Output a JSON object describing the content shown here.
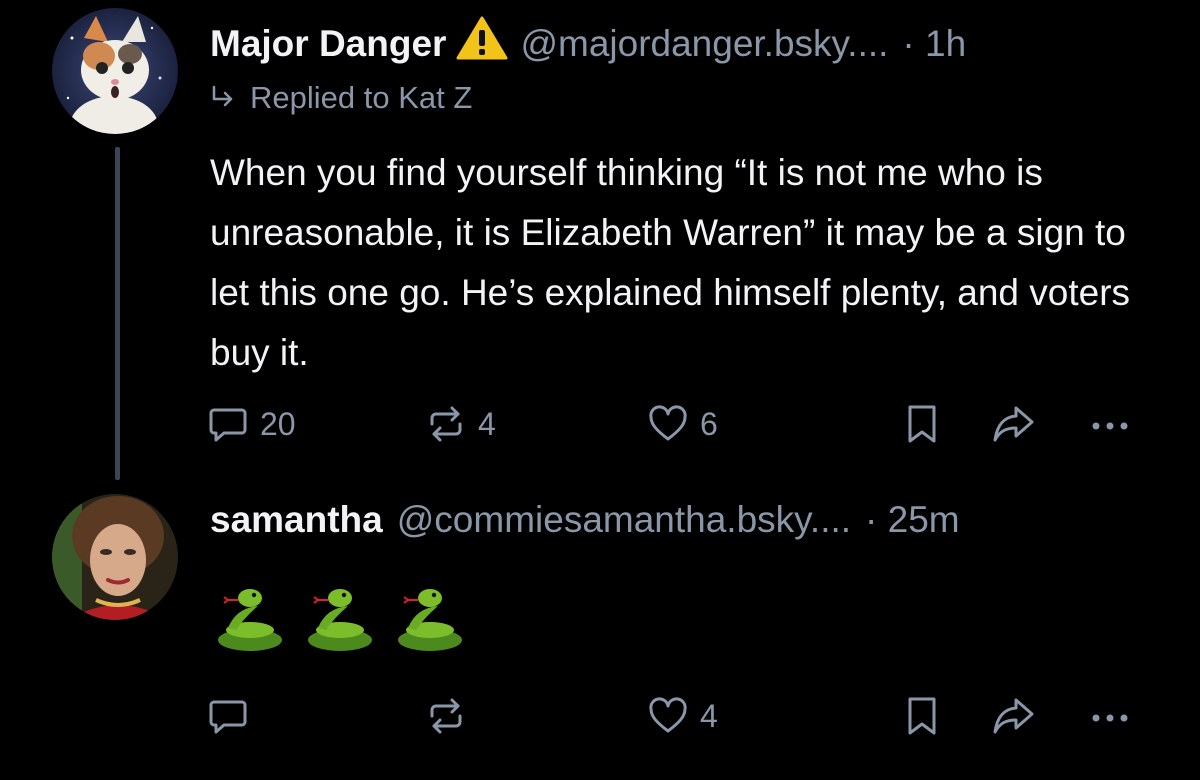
{
  "post1": {
    "author_name": "Major Danger",
    "warning_emoji": "⚠",
    "handle": "@majordanger.bsky....",
    "time": "· 1h",
    "reply_to": "Replied to Kat Z",
    "text": "When you find yourself thinking “It is not me who is unreasonable, it is Elizabeth Warren” it may be a sign to let this one go. He’s explained himself plenty, and voters buy it.",
    "reply_count": "20",
    "repost_count": "4",
    "like_count": "6",
    "more_label": "···"
  },
  "post2": {
    "author_name": "samantha",
    "handle": "@commiesamantha.bsky....",
    "time": "· 25m",
    "emojis": [
      "🐍",
      "🐍",
      "🐍"
    ],
    "like_count": "4",
    "more_label": "···"
  },
  "colors": {
    "background": "#000000",
    "text": "#f1f3f5",
    "muted": "#8a97a8",
    "thread_line": "#3a4654",
    "warning": "#f2c318"
  },
  "icons": {
    "reply": "reply-icon",
    "repost": "repost-icon",
    "like": "heart-icon",
    "bookmark": "bookmark-icon",
    "share": "share-icon",
    "more": "more-icon"
  }
}
